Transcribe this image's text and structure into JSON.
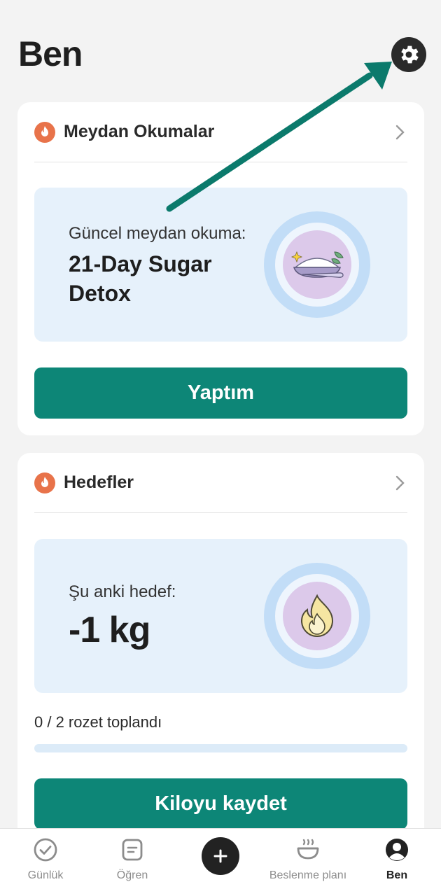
{
  "header": {
    "title": "Ben",
    "settings_icon": "gear-icon"
  },
  "challenges": {
    "title": "Meydan Okumalar",
    "current_label": "Güncel meydan okuma:",
    "current_name": "21-Day Sugar Detox",
    "action_label": "Yaptım"
  },
  "goals": {
    "title": "Hedefler",
    "current_label": "Şu anki hedef:",
    "current_value": "-1 kg",
    "badges_text": "0 / 2 rozet toplandı",
    "badges_progress": 0,
    "action_label": "Kiloyu kaydet"
  },
  "nav": {
    "items": [
      {
        "label": "Günlük",
        "icon": "check-circle-icon"
      },
      {
        "label": "Öğren",
        "icon": "document-icon"
      },
      {
        "label": "",
        "icon": "plus-icon"
      },
      {
        "label": "Beslenme planı",
        "icon": "bowl-icon"
      },
      {
        "label": "Ben",
        "icon": "profile-icon",
        "active": true
      }
    ]
  },
  "colors": {
    "accent": "#0d8677",
    "flame": "#e8734a",
    "panel": "#e6f1fb",
    "arrow": "#0b7a6c"
  }
}
